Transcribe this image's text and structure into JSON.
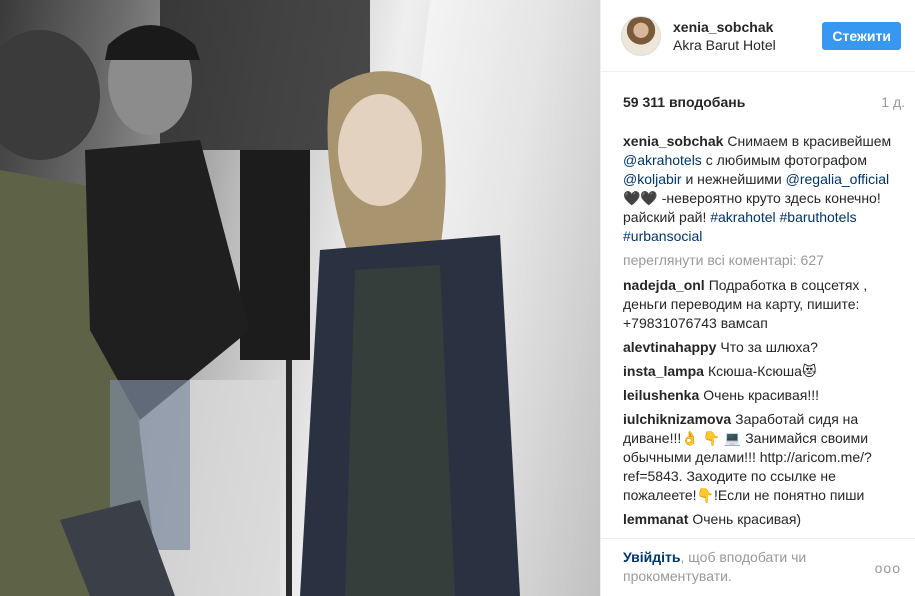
{
  "header": {
    "username": "xenia_sobchak",
    "location": "Akra Barut Hotel",
    "follow_label": "Стежити"
  },
  "stats": {
    "likes": "59 311 вподобань",
    "time_ago": "1 д."
  },
  "caption": {
    "user": "xenia_sobchak",
    "t1": "Снимаем в красивейшем ",
    "m1": "@akrahotels",
    "t2": " с любимым фотографом ",
    "m2": "@koljabir",
    "t3": " и нежнейшими ",
    "m3": "@regalia_official",
    "t4": " 🖤🖤 -невероятно круто здесь конечно! райский рай! ",
    "h1": "#akrahotel",
    "h2": "#baruthotels",
    "h3": "#urbansocial"
  },
  "view_all": "переглянути всі коментарі: 627",
  "comments": [
    {
      "user": "nadejda_onl",
      "text": "Подработка в соцсетях , деньги переводим на карту, пишите: +79831076743 вамсап"
    },
    {
      "user": "alevtinahappy",
      "text": "Что за шлюха?"
    },
    {
      "user": "insta_lampa",
      "text": "Ксюша-Ксюша😻"
    },
    {
      "user": "leilushenka",
      "text": "Очень красивая!!!"
    },
    {
      "user": "iulchiknizamova",
      "text": "Заработай сидя на диване!!!👌 👇 💻 Занимайся своими обычными делами!!! http://aricom.me/?ref=5843. Заходите по ссылке не пожалеете!👇!Если не понятно пиши"
    },
    {
      "user": "lemmanat",
      "text": "Очень красивая)"
    }
  ],
  "footer": {
    "login_link": "Увійдіть",
    "login_text": ", щоб вподобати чи прокоментувати.",
    "more_icon": "ooo"
  }
}
